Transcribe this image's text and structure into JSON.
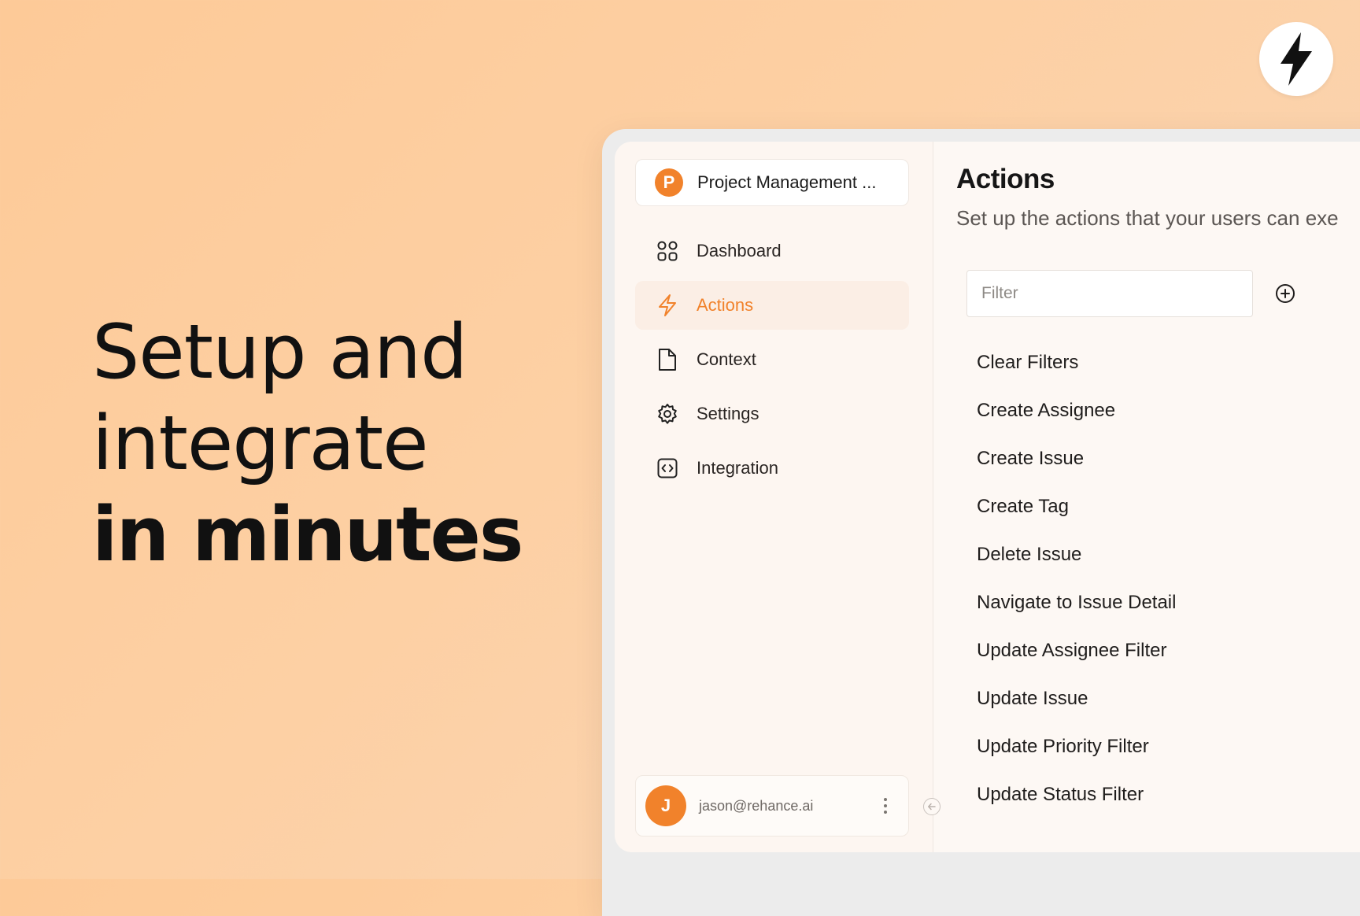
{
  "headline": {
    "line1": "Setup and",
    "line2": "integrate",
    "line3": "in minutes"
  },
  "logo": {
    "icon": "lightning-bolt-icon"
  },
  "sidebar": {
    "project": {
      "initial": "P",
      "name": "Project Management ..."
    },
    "items": [
      {
        "label": "Dashboard",
        "icon": "dashboard-grid-icon",
        "active": false
      },
      {
        "label": "Actions",
        "icon": "lightning-icon",
        "active": true
      },
      {
        "label": "Context",
        "icon": "document-icon",
        "active": false
      },
      {
        "label": "Settings",
        "icon": "gear-icon",
        "active": false
      },
      {
        "label": "Integration",
        "icon": "code-brackets-icon",
        "active": false
      }
    ],
    "user": {
      "initial": "J",
      "email": "jason@rehance.ai"
    }
  },
  "main": {
    "title": "Actions",
    "subtitle": "Set up the actions that your users can exe",
    "filter": {
      "placeholder": "Filter",
      "value": ""
    },
    "actions": [
      "Clear Filters",
      "Create Assignee",
      "Create Issue",
      "Create Tag",
      "Delete Issue",
      "Navigate to Issue Detail",
      "Update Assignee Filter",
      "Update Issue",
      "Update Priority Filter",
      "Update Status Filter"
    ]
  },
  "colors": {
    "accent": "#f1822b",
    "background": "#fdca98",
    "text": "#16120f"
  }
}
